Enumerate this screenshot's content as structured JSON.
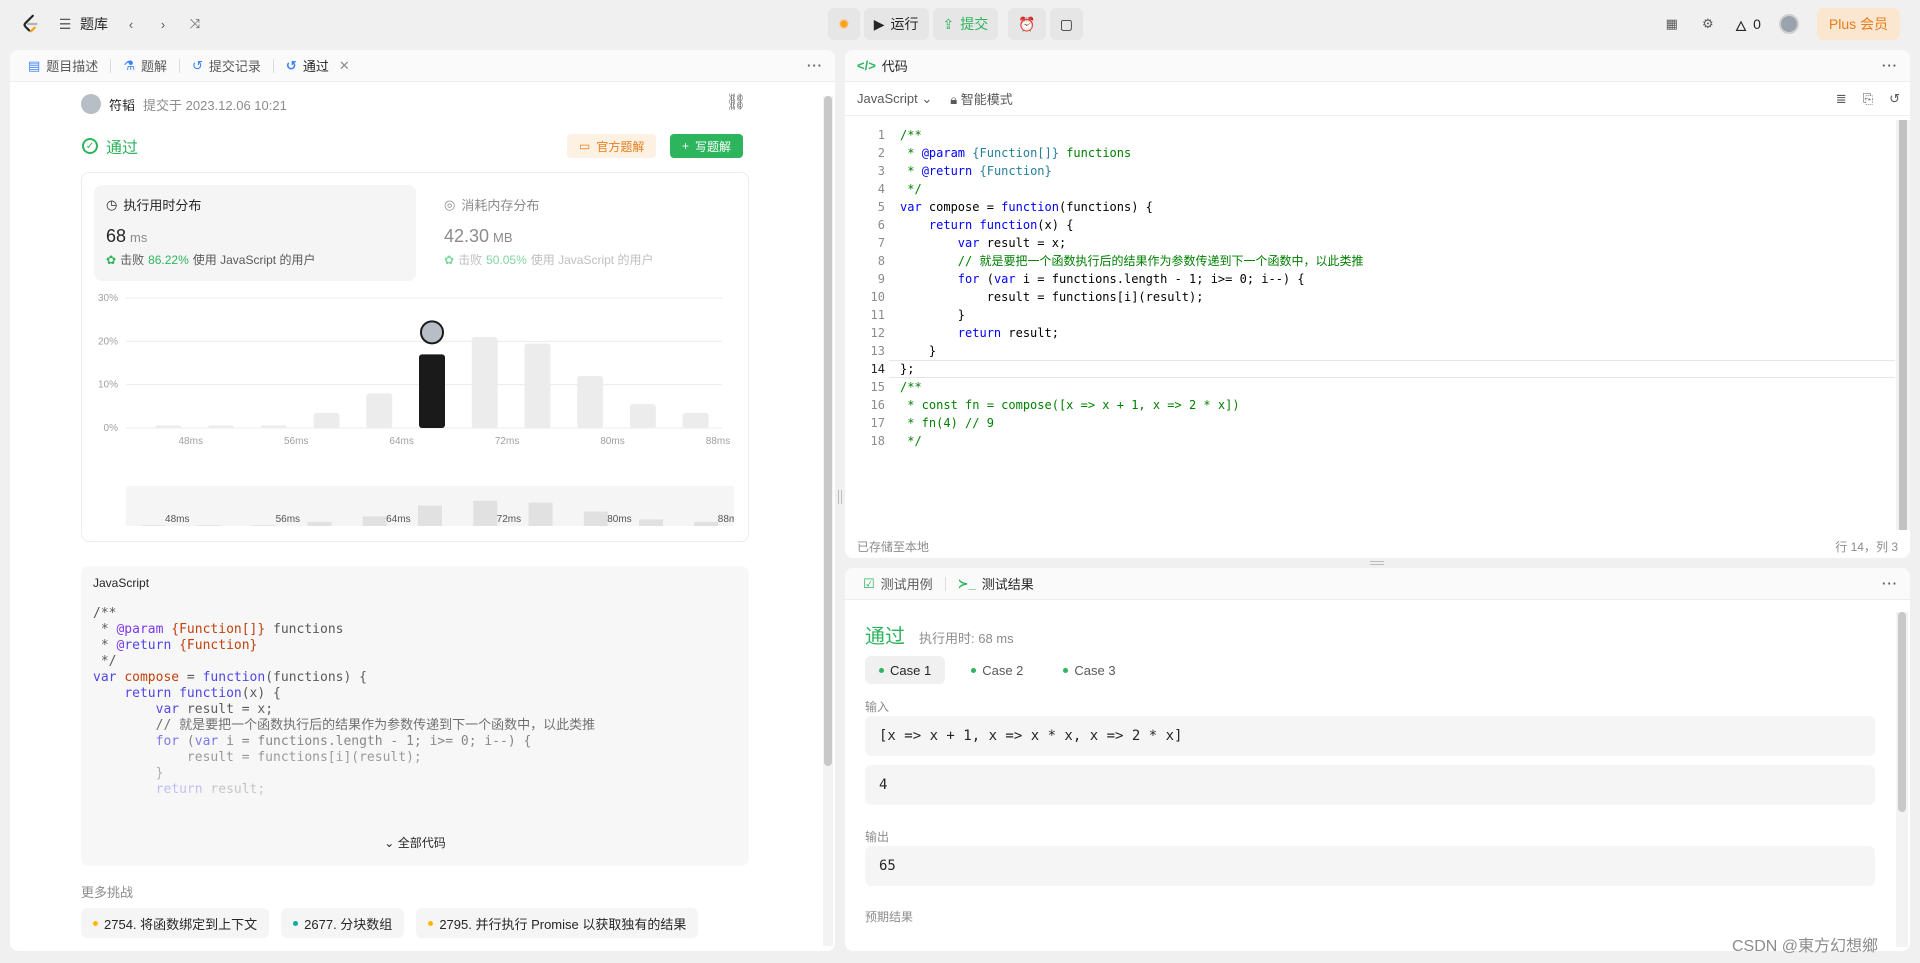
{
  "topbar": {
    "problem_list": "题库",
    "run": "运行",
    "submit": "提交",
    "streak": "0",
    "plus": "Plus 会员"
  },
  "left_tabs": [
    {
      "label": "题目描述"
    },
    {
      "label": "题解"
    },
    {
      "label": "提交记录"
    },
    {
      "label": "通过"
    }
  ],
  "submission": {
    "author": "符韬",
    "submitted_at": "提交于 2023.12.06 10:21",
    "status": "通过",
    "official_solution": "官方题解",
    "write_solution": "写题解"
  },
  "runtime": {
    "title": "执行用时分布",
    "value": "68",
    "unit": "ms",
    "beat_prefix": "击败",
    "beat_pct": "86.22%",
    "beat_suffix": "使用 JavaScript 的用户"
  },
  "memory": {
    "title": "消耗内存分布",
    "value": "42.30",
    "unit": "MB",
    "beat_prefix": "击败",
    "beat_pct": "50.05%",
    "beat_suffix": "使用 JavaScript 的用户"
  },
  "chart_data": {
    "type": "bar",
    "categories": [
      "46ms",
      "50ms",
      "54ms",
      "58ms",
      "62ms",
      "66ms",
      "70ms",
      "74ms",
      "78ms",
      "82ms",
      "86ms"
    ],
    "values": [
      0.6,
      0.6,
      0.6,
      3.5,
      8,
      17,
      21,
      19.5,
      12,
      5.5,
      3.5
    ],
    "highlight_index": 5,
    "x_ticks": [
      "48ms",
      "56ms",
      "64ms",
      "72ms",
      "80ms",
      "88ms"
    ],
    "y_ticks": [
      "0%",
      "10%",
      "20%",
      "30%"
    ],
    "ylim": [
      0,
      30
    ],
    "colors": {
      "bar": "#ececec",
      "highlight": "#1a1a1a",
      "brush_bar": "#e1e1e1"
    }
  },
  "code_preview": {
    "lang": "JavaScript",
    "expand": "全部代码"
  },
  "more_challenges": {
    "title": "更多挑战",
    "items": [
      {
        "label": "2754. 将函数绑定到上下文",
        "color": "#ffb800"
      },
      {
        "label": "2677. 分块数组",
        "color": "#00af9b"
      },
      {
        "label": "2795. 并行执行 Promise 以获取独有的结果",
        "color": "#ffb800"
      }
    ]
  },
  "code_panel": {
    "title": "代码",
    "language": "JavaScript",
    "smart_mode": "智能模式",
    "saved": "已存储至本地",
    "cursor": "行 14，列 3"
  },
  "code_lines": [
    "/**",
    " * @param {Function[]} functions",
    " * @return {Function}",
    " */",
    "var compose = function(functions) {",
    "    return function(x) {",
    "        var result = x;",
    "        // 就是要把一个函数执行后的结果作为参数传递到下一个函数中，以此类推",
    "        for (var i = functions.length - 1; i>= 0; i--) {",
    "            result = functions[i](result);",
    "        }",
    "        return result;",
    "    }",
    "};",
    "/**",
    " * const fn = compose([x => x + 1, x => 2 * x])",
    " * fn(4) // 9",
    " */"
  ],
  "result_panel": {
    "tab_testcase": "测试用例",
    "tab_result": "测试结果",
    "status": "通过",
    "runtime": "执行用时: 68 ms",
    "cases": [
      "Case 1",
      "Case 2",
      "Case 3"
    ],
    "input_label": "输入",
    "input_1": "[x => x + 1, x => x * x, x => 2 * x]",
    "input_2": "4",
    "output_label": "输出",
    "output": "65",
    "expected_label": "预期结果"
  },
  "watermark": "CSDN @東方幻想鄉"
}
